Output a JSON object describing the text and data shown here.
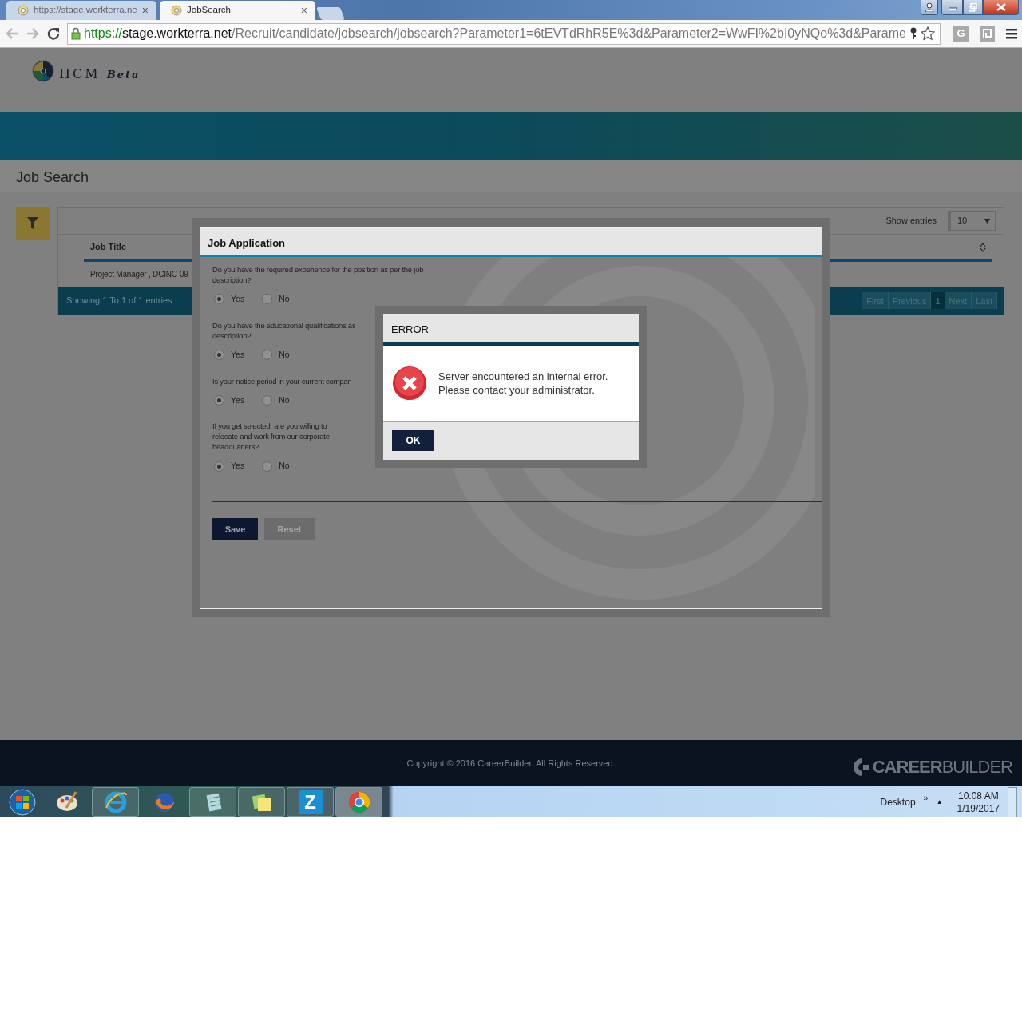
{
  "browser": {
    "tabs": [
      {
        "title": "https://stage.workterra.ne",
        "selected": false
      },
      {
        "title": "JobSearch",
        "selected": true
      }
    ],
    "close_glyph": "×",
    "address": {
      "scheme": "https://",
      "host": "stage.workterra.net",
      "path": "/Recruit/candidate/jobsearch/jobsearch?Parameter1=6tEVTdRhR5E%3d&Parameter2=WwFI%2bI0yNQo%3d&Parame"
    },
    "extension_label": "G"
  },
  "header": {
    "brand": "HCM",
    "badge": "Beta"
  },
  "page_title": "Job Search",
  "table": {
    "show_entries_label": "Show entries",
    "page_size": "10",
    "columns": [
      {
        "label": "Job Title"
      }
    ],
    "rows": [
      [
        "Project Manager , DCINC-09"
      ]
    ],
    "info": "Showing 1 To 1 of 1 entries",
    "pagination": [
      {
        "label": "First",
        "selected": false
      },
      {
        "label": "Previous",
        "selected": false
      },
      {
        "label": "1",
        "selected": true
      },
      {
        "label": "Next",
        "selected": false
      },
      {
        "label": "Last",
        "selected": false
      }
    ]
  },
  "job_dialog": {
    "title": "Job Application",
    "questions": [
      {
        "text": "Do you have the required experience for the position as per the job\ndescription?",
        "options": [
          {
            "label": "Yes",
            "selected": true
          },
          {
            "label": "No",
            "selected": false
          }
        ]
      },
      {
        "text": "Do you have the educational qualifications as\ndescription?",
        "options": [
          {
            "label": "Yes",
            "selected": true
          },
          {
            "label": "No",
            "selected": false
          }
        ]
      },
      {
        "text": "Is your notice period in your current compan",
        "options": [
          {
            "label": "Yes",
            "selected": true
          },
          {
            "label": "No",
            "selected": false
          }
        ]
      },
      {
        "text": "If you get selected, are you willing to\nrelocate and work from our corporate\nheadquarters?",
        "options": [
          {
            "label": "Yes",
            "selected": true
          },
          {
            "label": "No",
            "selected": false
          }
        ]
      }
    ],
    "buttons": [
      {
        "label": "Save",
        "disabled": false
      },
      {
        "label": "Reset",
        "disabled": true
      }
    ]
  },
  "error_dialog": {
    "title": "ERROR",
    "message": "Server encountered an internal error.\nPlease contact your administrator.",
    "button": "OK"
  },
  "footer": {
    "copyright": "Copyright © 2016 CareerBuilder. All Rights Reserved.",
    "logo_bold": "CAREER",
    "logo_light": "BUILDER"
  },
  "taskbar": {
    "z_label": "Z",
    "desktop": "Desktop",
    "chevron": "»",
    "tray_arrow": "▲",
    "time": "10:08 AM",
    "date": "1/19/2017"
  }
}
